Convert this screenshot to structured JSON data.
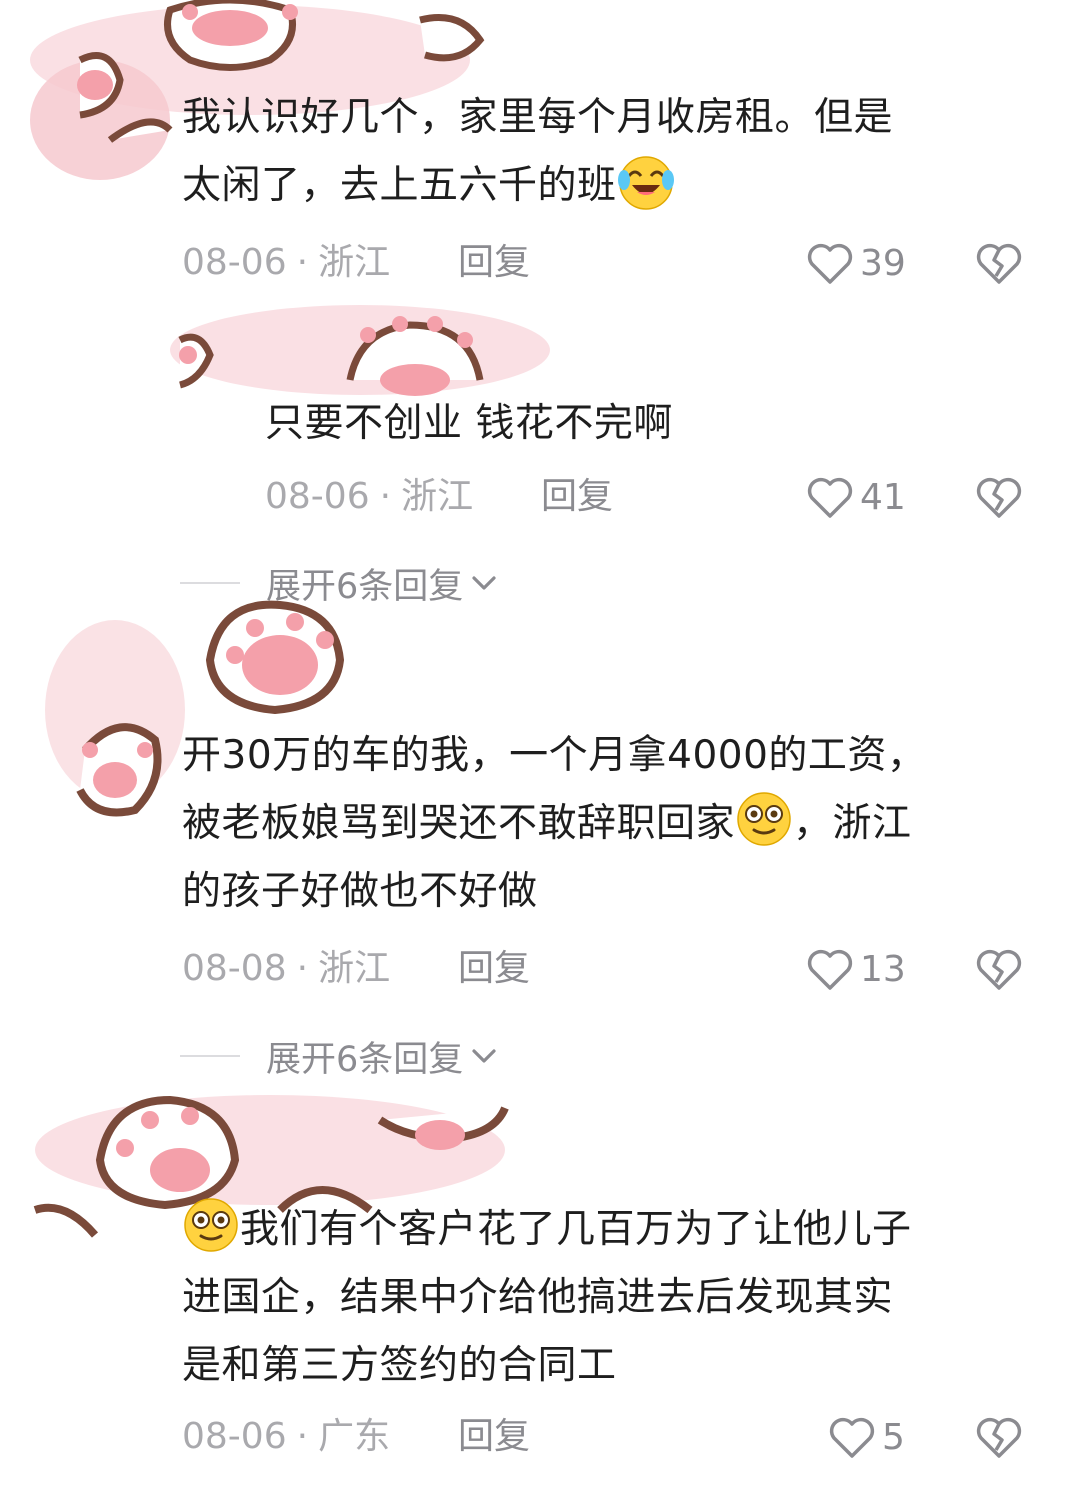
{
  "comments": [
    {
      "lines": [
        "我认识好几个，家里每个月收房租。但是",
        "太闲了，去上五六千的班"
      ],
      "emoji": "crying-laughing-emoji",
      "date": "08-06",
      "location": "浙江",
      "reply_label": "回复",
      "likes": "39",
      "reply": {
        "text": "只要不创业 钱花不完啊",
        "date": "08-06",
        "location": "浙江",
        "reply_label": "回复",
        "likes": "41"
      },
      "expand_label": "展开6条回复"
    },
    {
      "lines": [
        "开30万的车的我，一个月拿4000的工资，",
        "被老板娘骂到哭还不敢辞职回家",
        "，浙江",
        "的孩子好做也不好做"
      ],
      "emoji": "dizzy-face-emoji",
      "date": "08-08",
      "location": "浙江",
      "reply_label": "回复",
      "likes": "13",
      "expand_label": "展开6条回复"
    },
    {
      "lines": [
        "我们有个客户花了几百万为了让他儿子",
        "进国企，结果中介给他搞进去后发现其实",
        "是和第三方签约的合同工"
      ],
      "emoji": "dizzy-face-emoji",
      "date": "08-06",
      "location": "广东",
      "reply_label": "回复",
      "likes": "5"
    }
  ],
  "separator": "·",
  "colors": {
    "sticker_pink": "#f6c9cf",
    "sticker_brown": "#7a4a3a",
    "muted_text": "#a9a9ad",
    "body_text": "#1e1e1e"
  }
}
